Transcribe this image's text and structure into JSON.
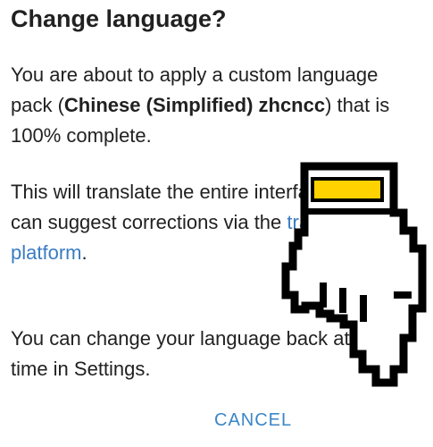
{
  "dialog": {
    "title": "Change language?",
    "p1_part1": "You are about to apply a custom language pack (",
    "p1_bold": "Chinese (Simplified) zhcncc",
    "p1_part2": ") that is 100% complete.",
    "p2_part1": "This will translate the entire interface. You can suggest corrections via the ",
    "p2_link": "translation platform",
    "p2_part2": ".",
    "p3": "You can change your language back at any time in Settings.",
    "cancel_label": "CANCEL"
  },
  "colors": {
    "link": "#3a7cc2",
    "button": "#3a86c8",
    "cursor_accent": "#ffd200"
  },
  "icons": {
    "cursor": "pointing-hand-icon"
  }
}
